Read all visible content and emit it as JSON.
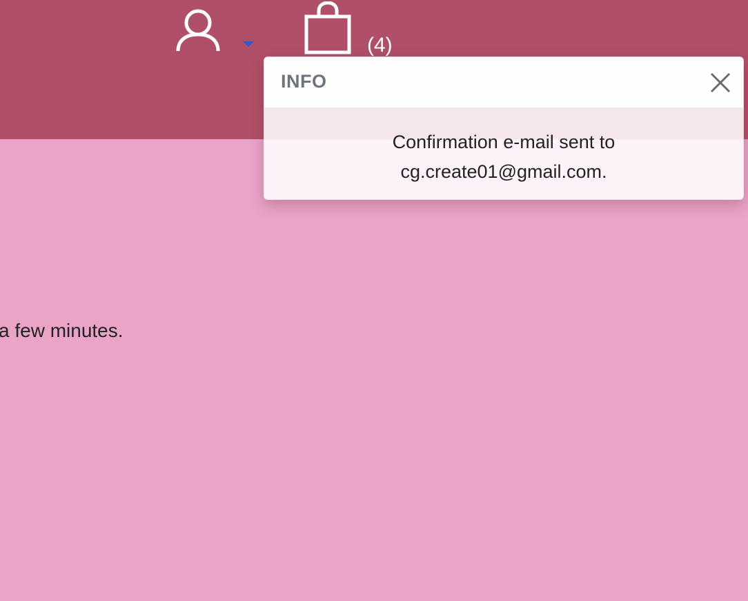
{
  "colors": {
    "header_bg": "#b05068",
    "page_bg": "#e9a4c8",
    "caret": "#3558c8",
    "toast_title": "#6c757d"
  },
  "header": {
    "account_icon": "user-icon",
    "account_caret_icon": "caret-down-icon",
    "cart_icon": "shopping-bag-icon",
    "cart_count": "(4)"
  },
  "main": {
    "text": "a few minutes."
  },
  "toast": {
    "title": "INFO",
    "close_icon": "close-icon",
    "message_line1": "Confirmation e-mail sent to",
    "message_line2": "cg.create01@gmail.com."
  }
}
